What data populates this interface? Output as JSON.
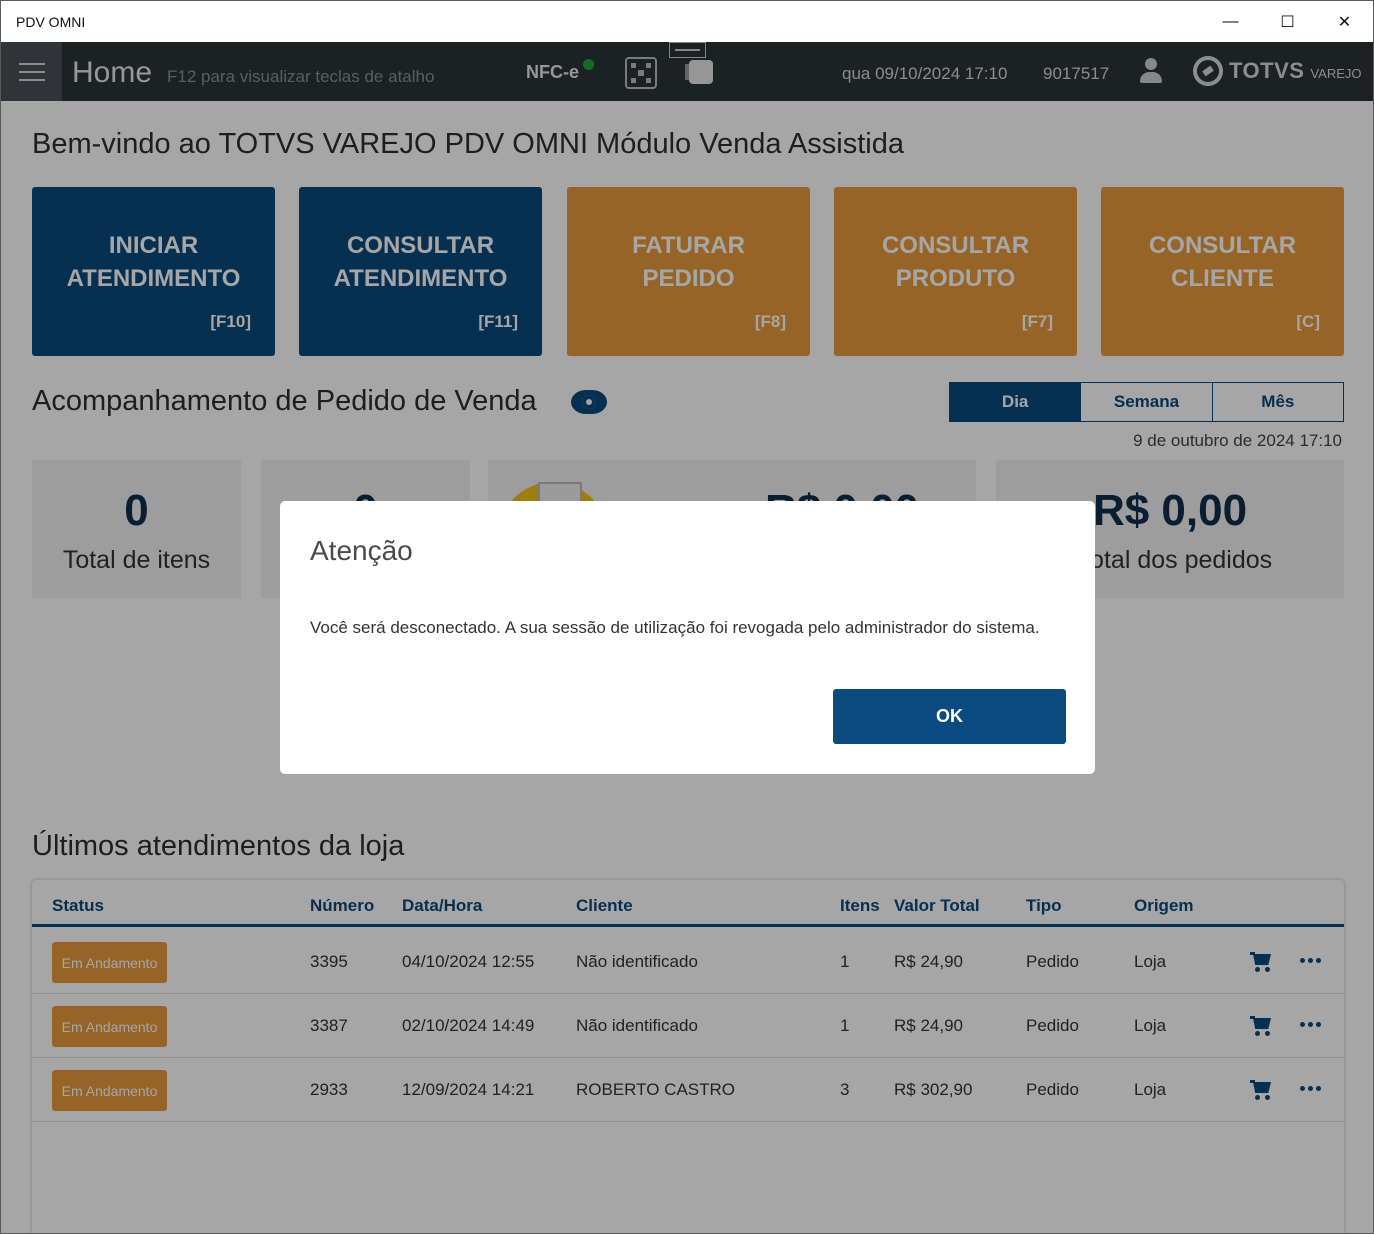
{
  "window": {
    "title": "PDV OMNI",
    "controls": {
      "minimize": "—",
      "maximize": "☐",
      "close": "✕"
    }
  },
  "appbar": {
    "page_title": "Home",
    "shortcut_hint": "F12 para visualizar teclas de atalho",
    "nfce_label": "NFC-e",
    "nfce_status_color": "#1fa83a",
    "datetime": "qua 09/10/2024 17:10",
    "user_id": "9017517",
    "brand_name": "TOTVS",
    "brand_sub": "VAREJO"
  },
  "welcome": "Bem-vindo ao TOTVS VAREJO PDV OMNI Módulo Venda Assistida",
  "tiles": [
    {
      "line1": "INICIAR",
      "line2": "ATENDIMENTO",
      "key": "[F10]",
      "color": "#0a4a7f"
    },
    {
      "line1": "CONSULTAR",
      "line2": "ATENDIMENTO",
      "key": "[F11]",
      "color": "#0a4a7f"
    },
    {
      "line1": "FATURAR",
      "line2": "PEDIDO",
      "key": "[F8]",
      "color": "#e99a3c"
    },
    {
      "line1": "CONSULTAR",
      "line2": "PRODUTO",
      "key": "[F7]",
      "color": "#e99a3c"
    },
    {
      "line1": "CONSULTAR",
      "line2": "CLIENTE",
      "key": "[C]",
      "color": "#e99a3c"
    }
  ],
  "tracking": {
    "title": "Acompanhamento de Pedido de Venda",
    "periods": [
      "Dia",
      "Semana",
      "Mês"
    ],
    "active_period": "Dia",
    "date": "9 de outubro de 2024 17:10",
    "stats": [
      {
        "value": "0",
        "label": "Total de itens"
      },
      {
        "value": "0",
        "label": ""
      },
      {
        "value": "R$ 0,00",
        "label": ""
      },
      {
        "value": "R$ 0,00",
        "label": "r total dos pedidos"
      }
    ]
  },
  "latest": {
    "title": "Últimos atendimentos da loja",
    "headers": [
      "Status",
      "Número",
      "Data/Hora",
      "Cliente",
      "Itens",
      "Valor Total",
      "Tipo",
      "Origem"
    ],
    "rows": [
      {
        "status": "Em Andamento",
        "numero": "3395",
        "data": "04/10/2024 12:55",
        "cliente": "Não identificado",
        "itens": "1",
        "valor": "R$ 24,90",
        "tipo": "Pedido",
        "origem": "Loja"
      },
      {
        "status": "Em Andamento",
        "numero": "3387",
        "data": "02/10/2024 14:49",
        "cliente": "Não identificado",
        "itens": "1",
        "valor": "R$ 24,90",
        "tipo": "Pedido",
        "origem": "Loja"
      },
      {
        "status": "Em Andamento",
        "numero": "2933",
        "data": "12/09/2024 14:21",
        "cliente": "ROBERTO CASTRO",
        "itens": "3",
        "valor": "R$ 302,90",
        "tipo": "Pedido",
        "origem": "Loja"
      }
    ]
  },
  "modal": {
    "title": "Atenção",
    "message": "Você será desconectado. A sua sessão de utilização foi revogada pelo administrador do sistema.",
    "ok_label": "OK"
  }
}
